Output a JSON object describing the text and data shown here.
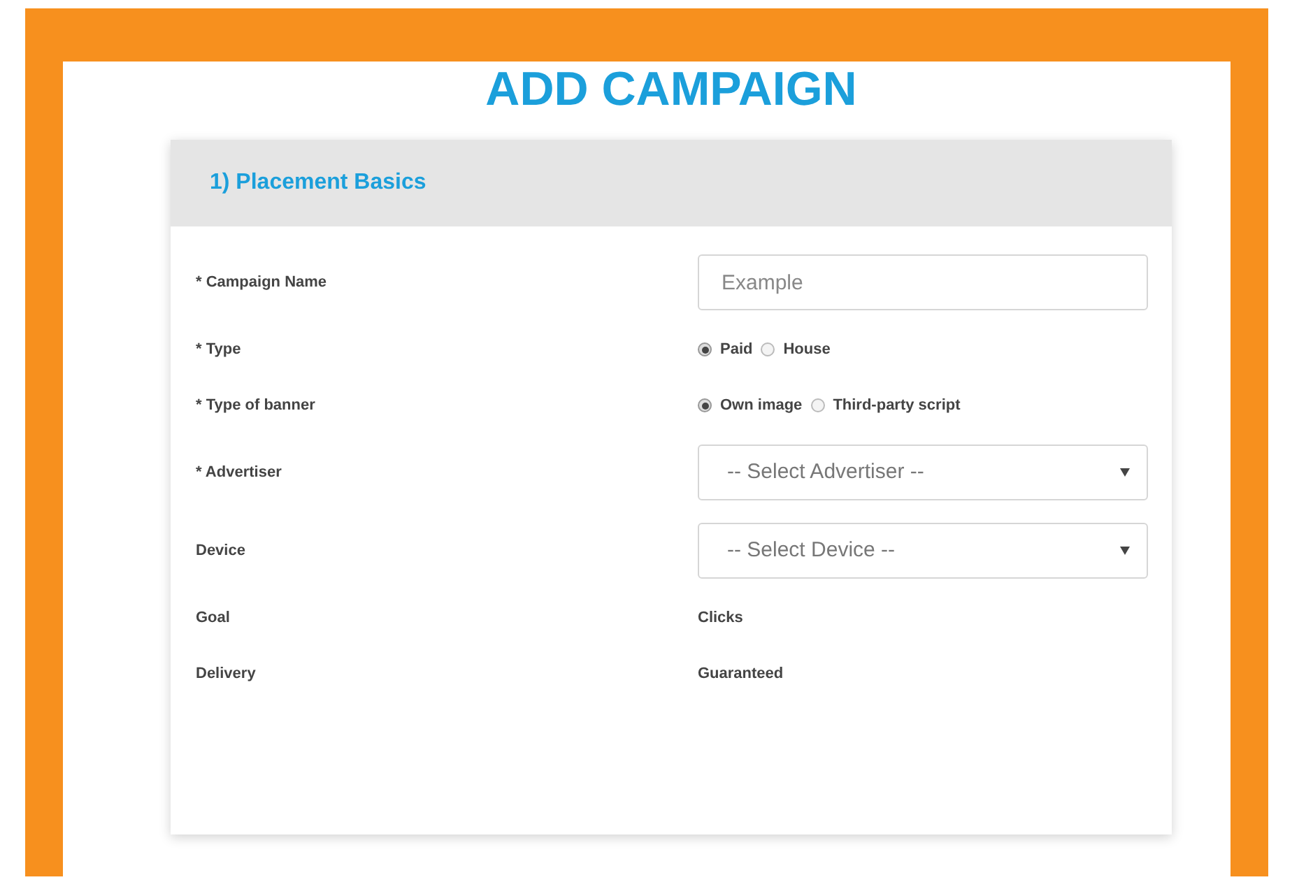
{
  "title": "ADD CAMPAIGN",
  "section": {
    "heading": "1) Placement Basics"
  },
  "fields": [
    {
      "kind": "text",
      "label": "* Campaign Name",
      "placeholder": "Example"
    },
    {
      "kind": "radio",
      "label": "* Type",
      "options": [
        {
          "label": "Paid",
          "selected": true
        },
        {
          "label": "House",
          "selected": false
        }
      ]
    },
    {
      "kind": "radio",
      "label": "* Type of banner",
      "options": [
        {
          "label": "Own image",
          "selected": true
        },
        {
          "label": "Third-party script",
          "selected": false
        }
      ]
    },
    {
      "kind": "select",
      "label": "* Advertiser",
      "placeholder": "-- Select Advertiser --"
    },
    {
      "kind": "select",
      "label": "Device",
      "placeholder": "-- Select Device --"
    },
    {
      "kind": "static",
      "label": "Goal",
      "value": "Clicks"
    },
    {
      "kind": "static",
      "label": "Delivery",
      "value": "Guaranteed"
    }
  ]
}
